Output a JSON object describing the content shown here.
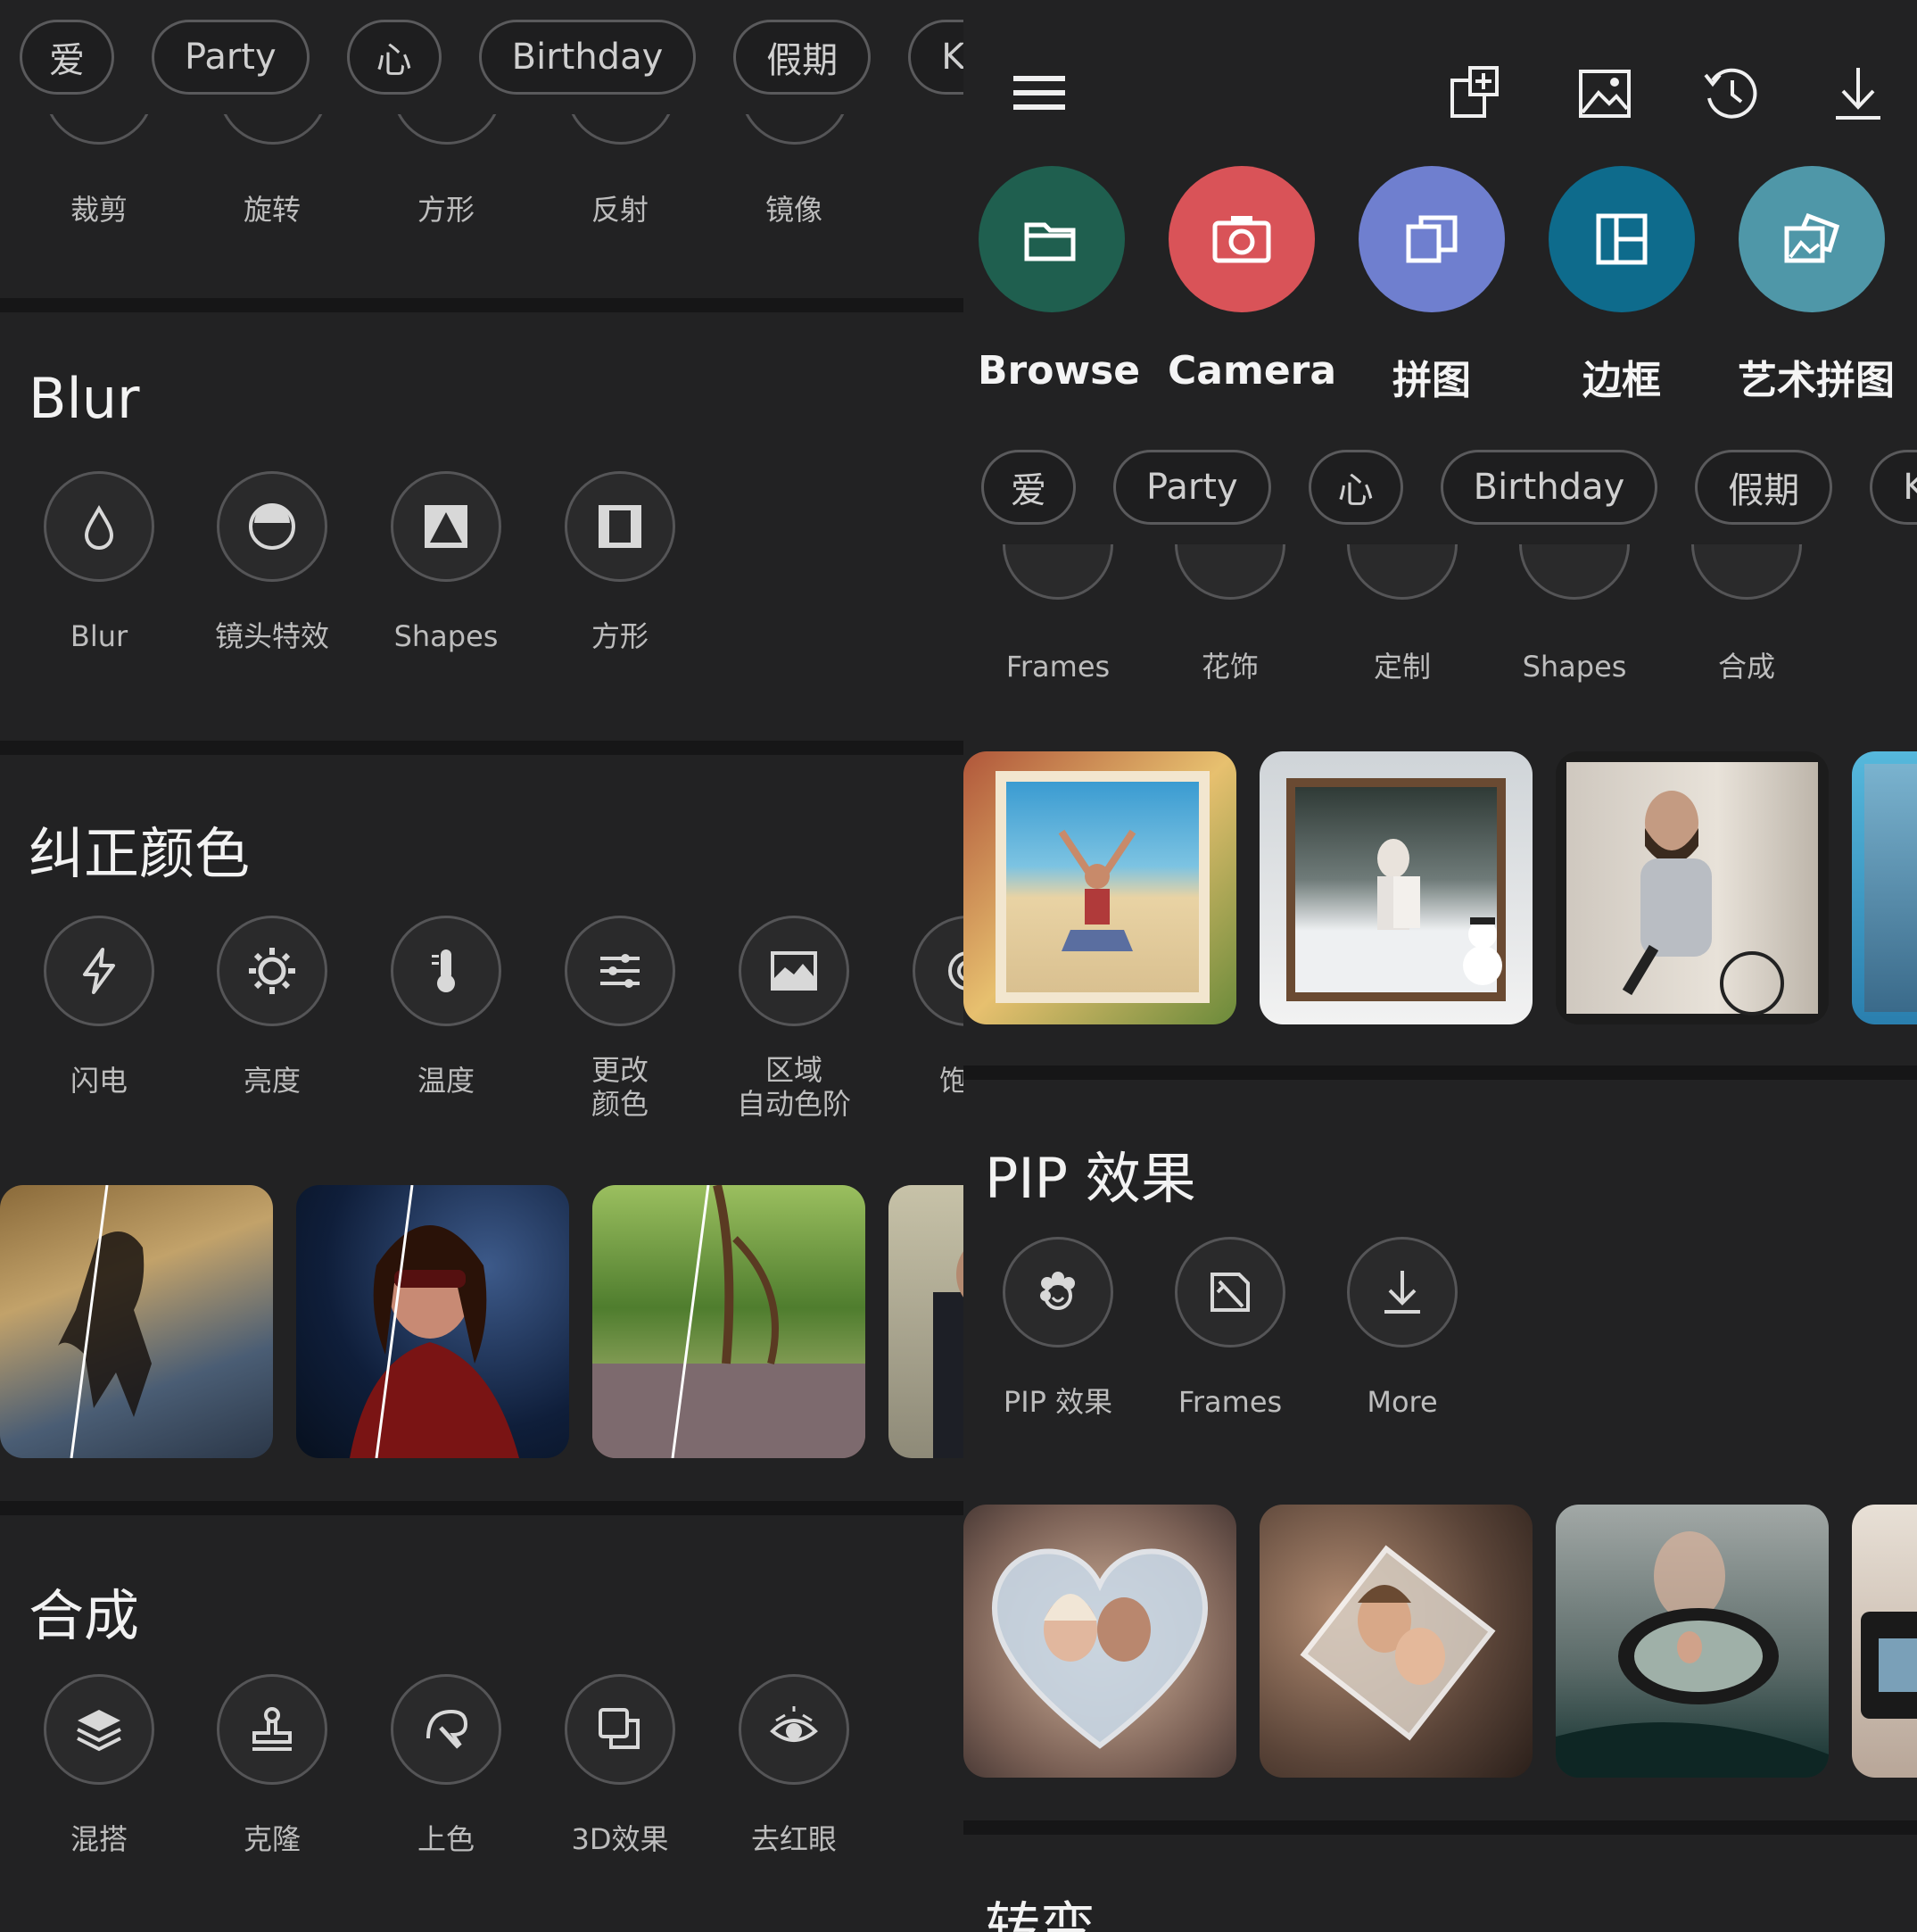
{
  "left": {
    "chips": [
      "爱",
      "Party",
      "心",
      "Birthday",
      "假期",
      "Kic"
    ],
    "top_tools": [
      "裁剪",
      "旋转",
      "方形",
      "反射",
      "镜像"
    ],
    "blur": {
      "title": "Blur",
      "tools": [
        "Blur",
        "镜头特效",
        "Shapes",
        "方形"
      ]
    },
    "color": {
      "title": "纠正颜色",
      "tools": [
        "闪电",
        "亮度",
        "温度",
        "更改\n颜色",
        "区域\n自动色阶",
        "饱和"
      ]
    },
    "compose": {
      "title": "合成",
      "tools": [
        "混搭",
        "克隆",
        "上色",
        "3D效果",
        "去红眼"
      ]
    }
  },
  "right": {
    "main_actions": [
      "Browse",
      "Camera",
      "拼图",
      "边框",
      "艺术拼图"
    ],
    "chips": [
      "爱",
      "Party",
      "心",
      "Birthday",
      "假期",
      "Kic"
    ],
    "frame_tools": [
      "Frames",
      "花饰",
      "定制",
      "Shapes",
      "合成"
    ],
    "pip": {
      "title": "PIP 效果",
      "tools": [
        "PIP 效果",
        "Frames",
        "More"
      ]
    },
    "next_section_title": "转变"
  },
  "colors": {
    "browse": "#1f5f4f",
    "camera": "#d95358",
    "collage": "#6f7fcf",
    "frame": "#0e6b8c",
    "art": "#4f97a8",
    "background": "#222223"
  }
}
